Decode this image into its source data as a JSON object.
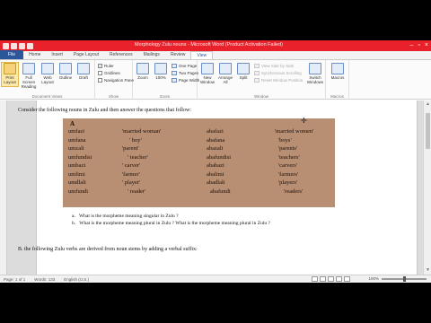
{
  "titlebar": {
    "title": "Morphology Zulu nouns - Microsoft Word (Product Activation Failed)",
    "controls": [
      "–",
      "▫",
      "×"
    ]
  },
  "tabs": [
    "File",
    "Home",
    "Insert",
    "Page Layout",
    "References",
    "Mailings",
    "Review",
    "View"
  ],
  "active_tab": "View",
  "ribbon": {
    "document_views": {
      "label": "Document Views",
      "buttons": [
        "Print Layout",
        "Full Screen Reading",
        "Web Layout",
        "Outline",
        "Draft"
      ]
    },
    "show": {
      "label": "Show",
      "checks": [
        {
          "label": "Ruler",
          "checked": true
        },
        {
          "label": "Gridlines",
          "checked": false
        },
        {
          "label": "Navigation Pane",
          "checked": false
        }
      ]
    },
    "zoom": {
      "label": "Zoom",
      "buttons": [
        "Zoom",
        "100%"
      ],
      "small": [
        "One Page",
        "Two Pages",
        "Page Width"
      ]
    },
    "window": {
      "label": "Window",
      "buttons": [
        "New Window",
        "Arrange All",
        "Split"
      ],
      "small": [
        "View Side by Side",
        "Synchronous Scrolling",
        "Reset Window Position"
      ],
      "switch": "Switch Windows"
    },
    "macros": {
      "label": "Macros",
      "button": "Macros"
    }
  },
  "document": {
    "intro": "Consider the following nouns in Zulu and then answer the questions that follow:",
    "table": {
      "header": "A",
      "col1": [
        "umfazi",
        "umfana",
        "umzali",
        "umfundisi",
        "umbazi",
        "umlimi",
        "umdlali",
        "umfundi"
      ],
      "col2": [
        "'married woman'",
        "' boy'",
        "'parent'",
        "' teacher'",
        "' carver'",
        "'farmer'",
        "' player'",
        "' reader'"
      ],
      "col3": [
        "abafazi",
        "abafana",
        "abazali",
        "abafundisi",
        "ababazi",
        "abalimi",
        "abadlali",
        "abafundi"
      ],
      "col4": [
        "'married women'",
        "'boys'",
        "'parents'",
        "'teachers'",
        "'carvers'",
        "'farmers'",
        "'players'",
        "'readers'"
      ]
    },
    "question_a_letter": "a.",
    "question_a": "What is the morpheme meaning singular in Zulu ?",
    "question_b_letter": "b.",
    "question_b": "What is the morpheme meaning plural in Zulu ? What is the morpheme meaning plural in Zulu ?",
    "next_section": "B. the following Zulu verbs are derived from noun stems by adding a verbal suffix:"
  },
  "statusbar": {
    "page": "Page: 1 of 1",
    "words": "Words: 133",
    "language": "English (U.S.)",
    "zoom": "100%"
  }
}
